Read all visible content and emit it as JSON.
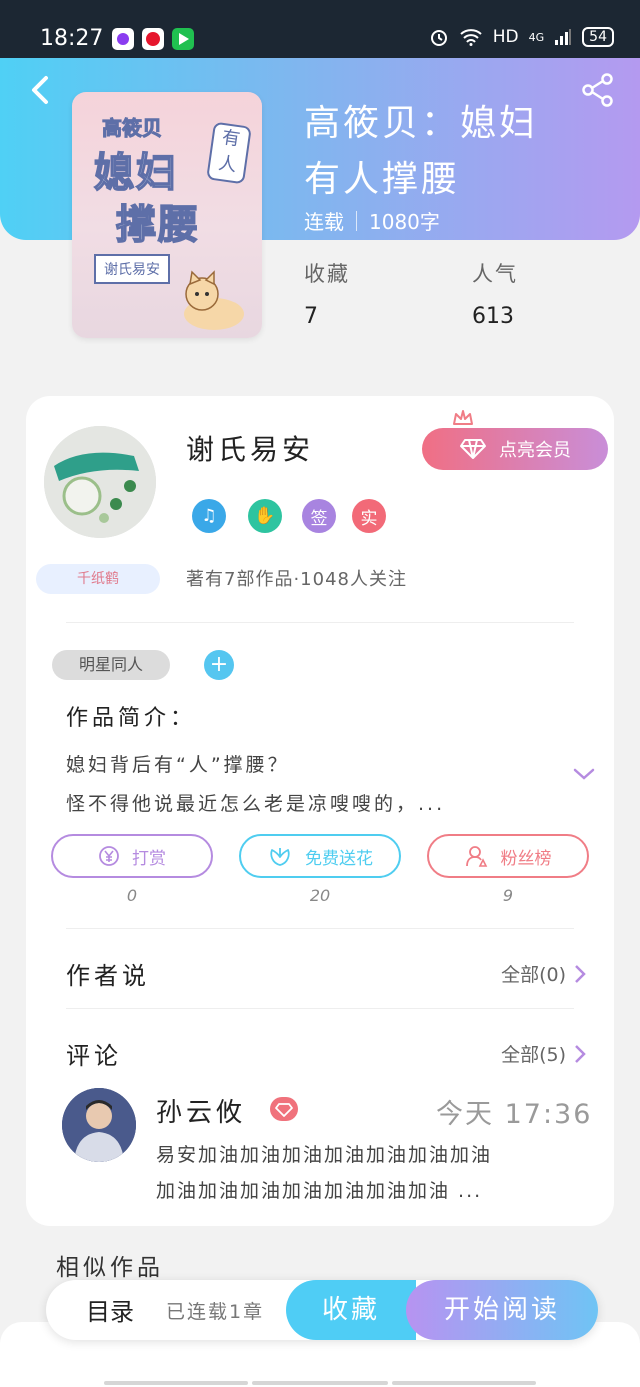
{
  "status_bar": {
    "time": "18:27",
    "network": "HD",
    "signal": "4G",
    "battery": "54"
  },
  "book": {
    "title_line1": "高筱贝：媳妇",
    "title_line2": "有人撑腰",
    "status": "连载",
    "word_count": "1080字",
    "fav_label": "收藏",
    "fav_count": "7",
    "pop_label": "人气",
    "pop_count": "613",
    "cover": {
      "line1": "高筱贝",
      "line2": "媳妇",
      "line3": "撑腰",
      "badge": "有人",
      "author": "谢氏易安"
    }
  },
  "author": {
    "name": "谢氏易安",
    "badge": "千纸鹤",
    "vip_label": "点亮会员",
    "medals": [
      {
        "icon": "music-medal-icon",
        "text": "♫",
        "color": "#3aa8e8"
      },
      {
        "icon": "handshake-medal-icon",
        "text": "✋",
        "color": "#2ec4a0"
      },
      {
        "icon": "sign-medal-icon",
        "text": "签",
        "color": "#a884e0"
      },
      {
        "icon": "verified-medal-icon",
        "text": "实",
        "color": "#f26a78"
      }
    ],
    "works_info": "著有7部作品·1048人关注"
  },
  "intro": {
    "tag": "明星同人",
    "tag_add": "+",
    "heading": "作品简介：",
    "line1": "媳妇背后有“人”撑腰？",
    "line2": "怪不得他说最近怎么老是凉嗖嗖的，..."
  },
  "actions": [
    {
      "label": "打赏",
      "count": "0",
      "color": "#b58be0"
    },
    {
      "label": "免费送花",
      "count": "20",
      "color": "#4fcdf0"
    },
    {
      "label": "粉丝榜",
      "count": "9",
      "color": "#f07d86"
    }
  ],
  "author_says": {
    "heading": "作者说",
    "more": "全部(0)"
  },
  "comments": {
    "heading": "评论",
    "more": "全部(5)",
    "items": [
      {
        "name": "孙云攸",
        "time": "今天 17:36",
        "line1": "易安加油加油加油加油加油加油加油",
        "line2": "加油加油加油加油加油加油加油 ..."
      }
    ]
  },
  "similar": {
    "heading": "相似作品"
  },
  "bottom_bar": {
    "toc": "目录",
    "chapters": "已连载1章",
    "fav": "收藏",
    "read": "开始阅读"
  },
  "colors": {
    "accent_cyan": "#4fcdf5",
    "accent_purple": "#b793f1",
    "vip_pink": "#f06f84"
  }
}
